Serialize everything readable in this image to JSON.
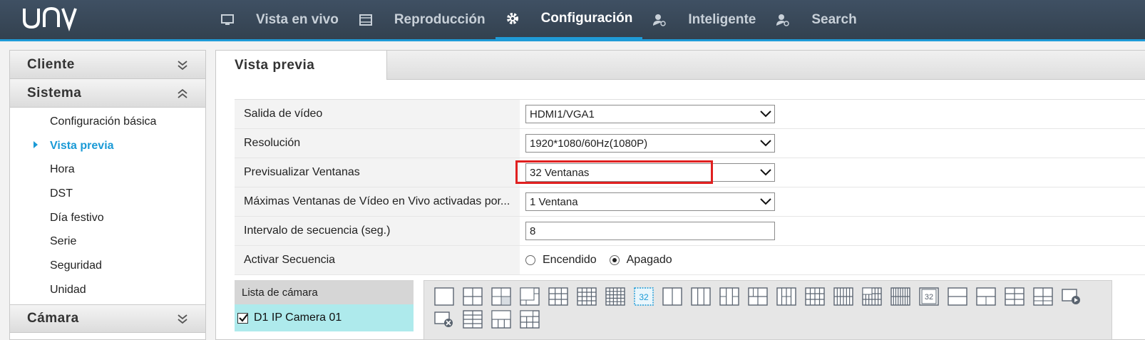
{
  "brand": "UNV",
  "nav": [
    {
      "label": "Vista en vivo",
      "icon": "monitor-icon",
      "active": false
    },
    {
      "label": "Reproducción",
      "icon": "film-icon",
      "active": false
    },
    {
      "label": "Configuración",
      "icon": "gear-icon",
      "active": true
    },
    {
      "label": "Inteligente",
      "icon": "person-search-icon",
      "active": false
    },
    {
      "label": "Search",
      "icon": "person-search-icon",
      "active": false
    }
  ],
  "sidebar": {
    "cliente": "Cliente",
    "sistema": "Sistema",
    "camara": "Cámara",
    "items": [
      {
        "label": "Configuración básica"
      },
      {
        "label": "Vista previa",
        "active": true
      },
      {
        "label": "Hora"
      },
      {
        "label": "DST"
      },
      {
        "label": "Día festivo"
      },
      {
        "label": "Serie"
      },
      {
        "label": "Seguridad"
      },
      {
        "label": "Unidad"
      }
    ]
  },
  "tab": "Vista previa",
  "form": {
    "salida_label": "Salida de vídeo",
    "salida_value": "HDMI1/VGA1",
    "resolucion_label": "Resolución",
    "resolucion_value": "1920*1080/60Hz(1080P)",
    "previsualizar_label": "Previsualizar Ventanas",
    "previsualizar_value": "32 Ventanas",
    "maximas_label": "Máximas Ventanas de Vídeo en Vivo activadas por...",
    "maximas_value": "1 Ventana",
    "intervalo_label": "Intervalo de secuencia (seg.)",
    "intervalo_value": "8",
    "activar_label": "Activar Secuencia",
    "encendido": "Encendido",
    "apagado": "Apagado",
    "selected": "apagado"
  },
  "camlist": {
    "header": "Lista de cámara",
    "items": [
      {
        "label": "D1 IP Camera 01",
        "checked": true
      }
    ]
  },
  "layouts": {
    "selected_label": "32",
    "pip_label": "32",
    "accent": "#1a9ad6"
  }
}
